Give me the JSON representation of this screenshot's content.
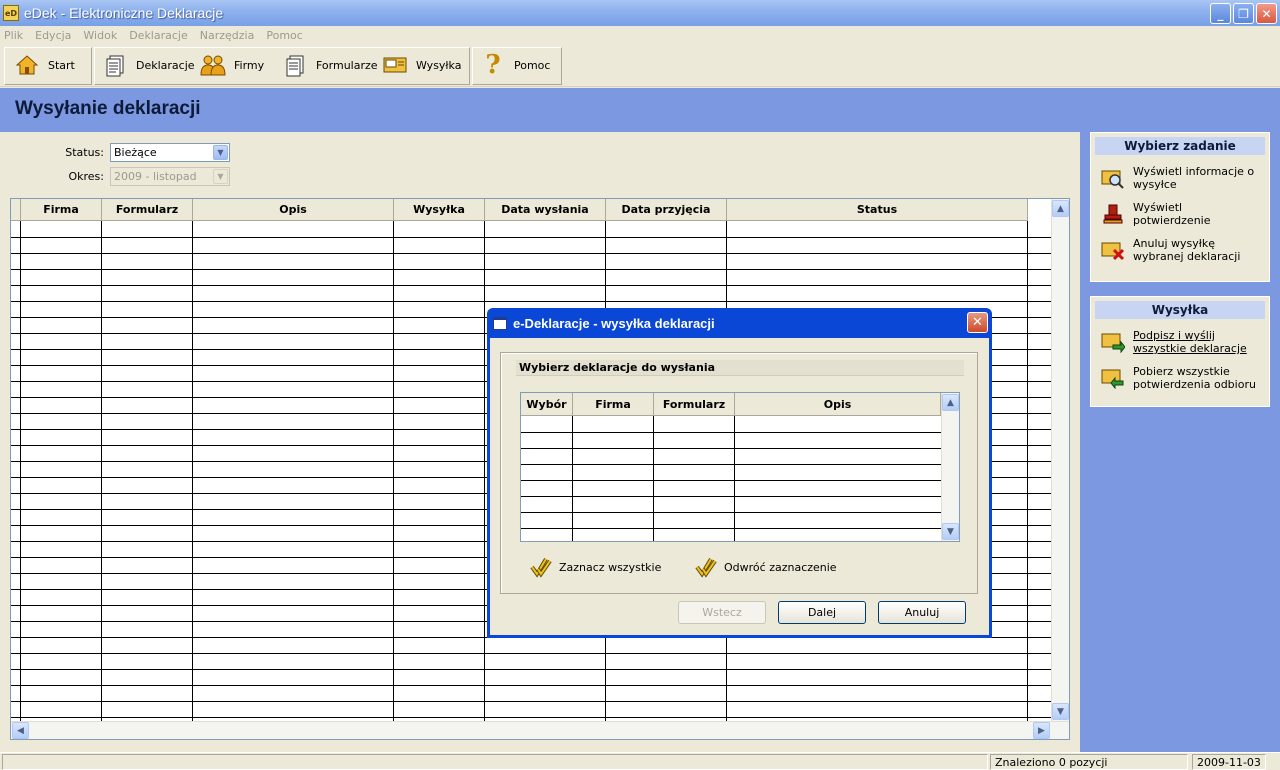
{
  "window": {
    "app_icon_text": "eD",
    "title": "eDek - Elektroniczne Deklaracje",
    "buttons": {
      "minimize": "_",
      "restore": "❐",
      "close": "✕"
    }
  },
  "menu": [
    "Plik",
    "Edycja",
    "Widok",
    "Deklaracje",
    "Narzędzia",
    "Pomoc"
  ],
  "toolbar": {
    "start": "Start",
    "deklaracje": "Deklaracje",
    "firmy": "Firmy",
    "formularze": "Formularze",
    "wysylka": "Wysyłka",
    "pomoc": "Pomoc"
  },
  "page": {
    "title": "Wysyłanie deklaracji"
  },
  "filters": {
    "status_label": "Status:",
    "status_value": "Bieżące",
    "okres_label": "Okres:",
    "okres_value": "2009 - listopad"
  },
  "grid": {
    "columns": [
      "Firma",
      "Formularz",
      "Opis",
      "Wysyłka",
      "Data wysłania",
      "Data przyjęcia",
      "Status"
    ]
  },
  "side_panel": {
    "zadanie_title": "Wybierz zadanie",
    "zadanie_items": [
      {
        "label": "Wyświetl informacje o wysyłce",
        "icon": "magnifier-icon"
      },
      {
        "label": "Wyświetl potwierdzenie",
        "icon": "stamp-icon"
      },
      {
        "label": "Anuluj wysyłkę wybranej deklaracji",
        "icon": "cancel-send-icon"
      }
    ],
    "wysylka_title": "Wysyłka",
    "wysylka_items": [
      {
        "label": "Podpisz i wyślij wszystkie deklaracje",
        "icon": "send-icon"
      },
      {
        "label": "Pobierz wszystkie potwierdzenia odbioru",
        "icon": "receive-icon"
      }
    ]
  },
  "dialog": {
    "title": "e-Deklaracje - wysyłka deklaracji",
    "section_title": "Wybierz deklaracje do wysłania",
    "columns": [
      "Wybór",
      "Firma",
      "Formularz",
      "Opis"
    ],
    "select_all": "Zaznacz wszystkie",
    "invert_selection": "Odwróć zaznaczenie",
    "back": "Wstecz",
    "next": "Dalej",
    "cancel": "Anuluj"
  },
  "status_bar": {
    "count": "Znaleziono 0 pozycji",
    "date": "2009-11-03"
  },
  "colors": {
    "header_band": "#7B98E0",
    "dialog_border": "#0A47D6",
    "panel_head": "#C7D4F2"
  }
}
